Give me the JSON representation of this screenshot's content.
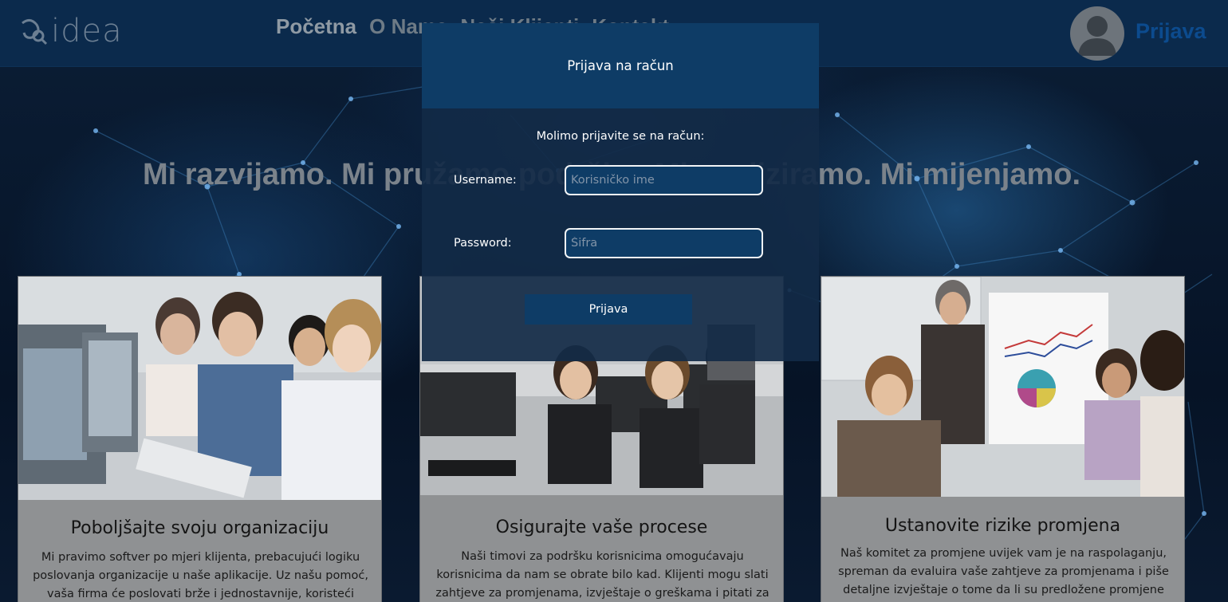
{
  "navbar": {
    "logo_text": "idea",
    "links": [
      "Početna",
      "O Nama",
      "Naši Klijenti",
      "Kontakt"
    ],
    "active_link": "Početna",
    "login_label": "Prijava"
  },
  "hero": {
    "title": "Mi razvijamo. Mi pružamo podršku. Mi analiziramo. Mi mijenjamo."
  },
  "cards": [
    {
      "title": "Poboljšajte svoju organizaciju",
      "text": "Mi pravimo softver po mjeri klijenta, prebacujući logiku poslovanja organizacije u naše aplikacije. Uz našu pomoć, vaša firma će poslovati brže i jednostavnije, koristeći"
    },
    {
      "title": "Osigurajte vaše procese",
      "text": "Naši timovi za podršku korisnicima omogućavaju korisnicima da nam se obrate bilo kad. Klijenti mogu slati zahtjeve za promjenama, izvještaje o greškama i pitati za"
    },
    {
      "title": "Ustanovite rizike promjena",
      "text": "Naš komitet za promjene uvijek vam je na raspolaganju, spreman da evaluira vaše zahtjeve za promjenama i piše detaljne izvještaje o tome da li su predložene promjene"
    }
  ],
  "modal": {
    "title": "Prijava na račun",
    "prompt": "Molimo prijavite se na račun:",
    "username_label": "Username:",
    "username_placeholder": "Korisničko ime",
    "password_label": "Password:",
    "password_placeholder": "Šifra",
    "submit_label": "Prijava"
  },
  "colors": {
    "navbar_bg": "#0b2a4c",
    "modal_header_bg": "#0e3c66",
    "login_link": "#0c4b8e",
    "card_bg": "#8f9193"
  },
  "icons": [
    "logo-mark-icon",
    "user-avatar-icon"
  ]
}
